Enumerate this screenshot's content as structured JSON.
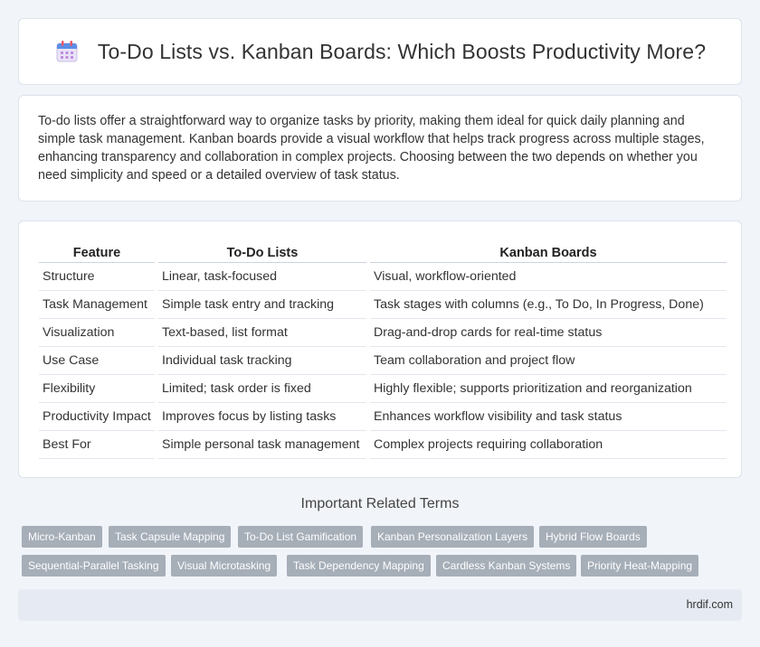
{
  "header": {
    "title": "To-Do Lists vs. Kanban Boards: Which Boosts Productivity More?",
    "icon": "calendar-icon"
  },
  "intro": {
    "text": "To-do lists offer a straightforward way to organize tasks by priority, making them ideal for quick daily planning and simple task management. Kanban boards provide a visual workflow that helps track progress across multiple stages, enhancing transparency and collaboration in complex projects. Choosing between the two depends on whether you need simplicity and speed or a detailed overview of task status."
  },
  "table": {
    "headers": [
      "Feature",
      "To-Do Lists",
      "Kanban Boards"
    ],
    "rows": [
      [
        "Structure",
        "Linear, task-focused",
        "Visual, workflow-oriented"
      ],
      [
        "Task Management",
        "Simple task entry and tracking",
        "Task stages with columns (e.g., To Do, In Progress, Done)"
      ],
      [
        "Visualization",
        "Text-based, list format",
        "Drag-and-drop cards for real-time status"
      ],
      [
        "Use Case",
        "Individual task tracking",
        "Team collaboration and project flow"
      ],
      [
        "Flexibility",
        "Limited; task order is fixed",
        "Highly flexible; supports prioritization and reorganization"
      ],
      [
        "Productivity Impact",
        "Improves focus by listing tasks",
        "Enhances workflow visibility and task status"
      ],
      [
        "Best For",
        "Simple personal task management",
        "Complex projects requiring collaboration"
      ]
    ]
  },
  "related": {
    "title": "Important Related Terms",
    "tags": [
      "Micro-Kanban",
      "Task Capsule Mapping",
      "To-Do List Gamification",
      "Kanban Personalization Layers",
      "Hybrid Flow Boards",
      "Sequential-Parallel Tasking",
      "Visual Microtasking",
      "Task Dependency Mapping",
      "Cardless Kanban Systems",
      "Priority Heat-Mapping"
    ]
  },
  "footer": {
    "site": "hrdif.com"
  },
  "colors": {
    "background": "#f1f4f9",
    "tag": "#a6aeb8",
    "footer": "#e6ebf3"
  }
}
